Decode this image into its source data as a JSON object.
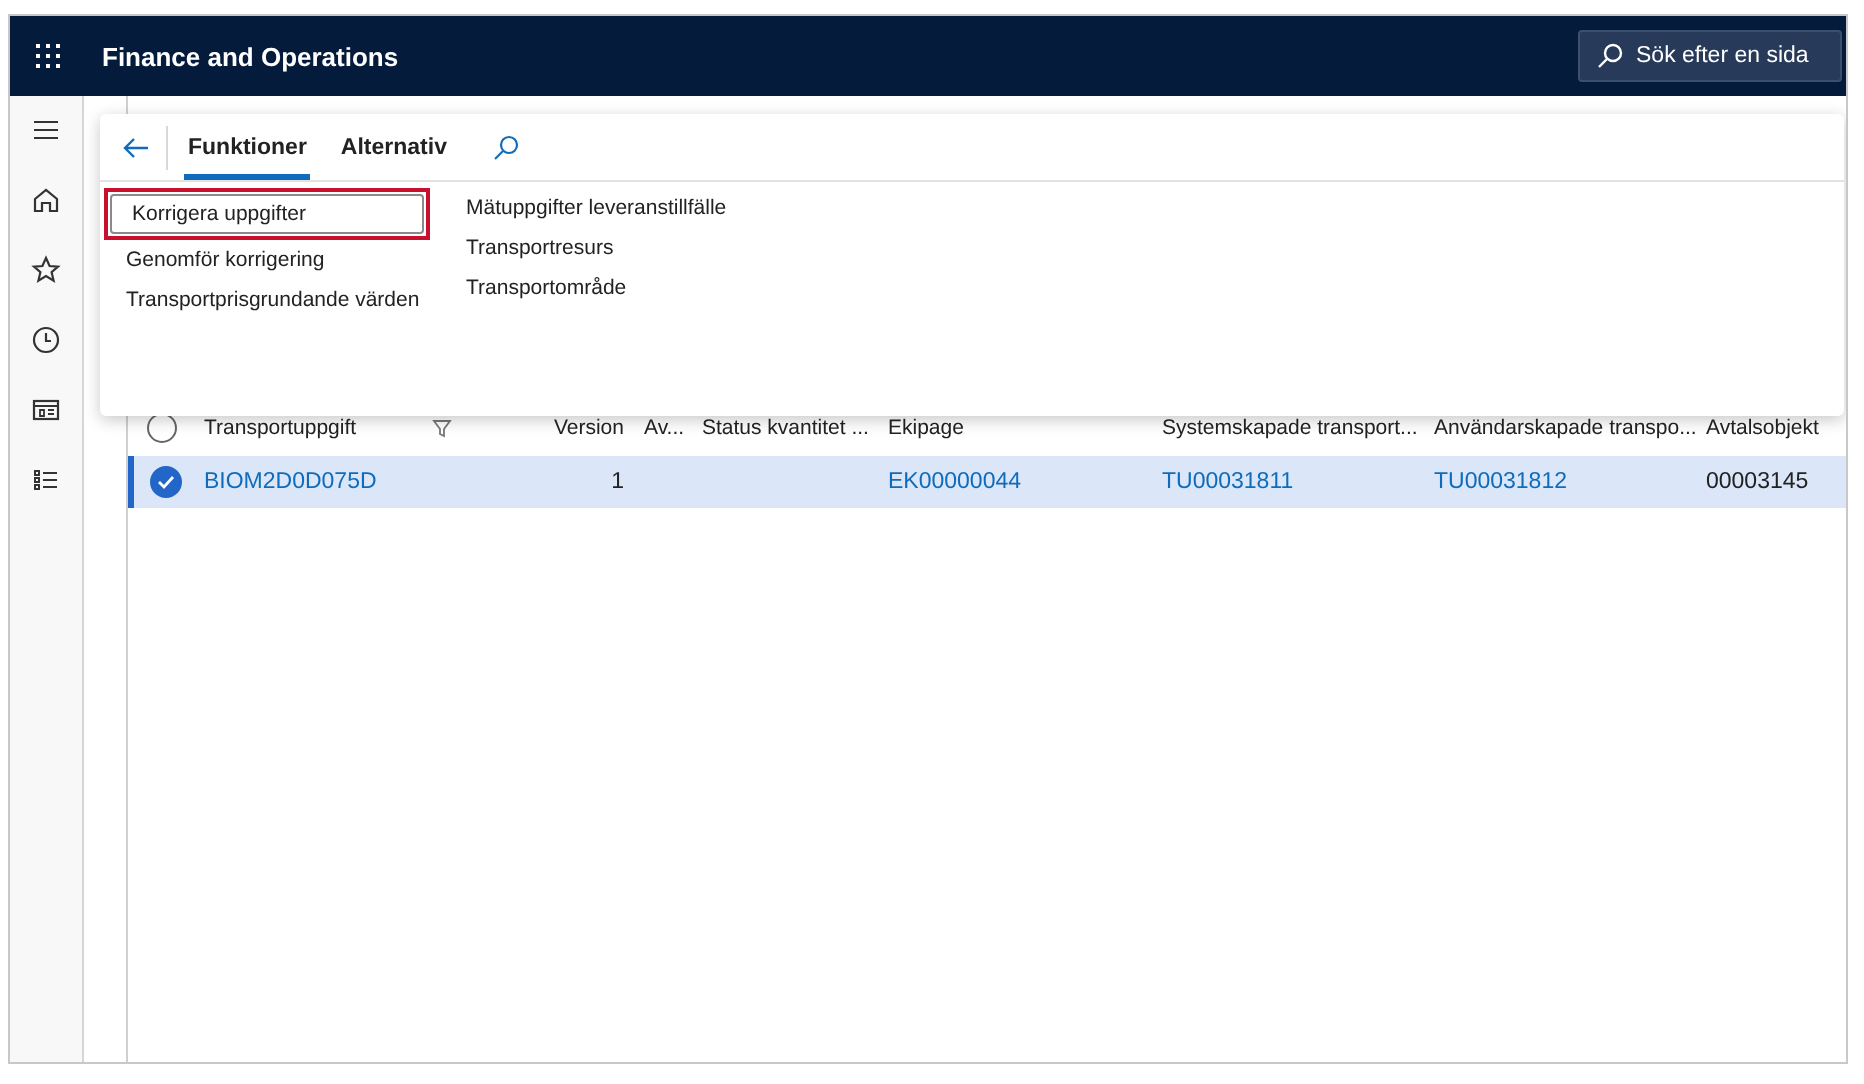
{
  "app_bar": {
    "title": "Finance and Operations",
    "search": {
      "placeholder": "Sök efter en sida"
    }
  },
  "action_pane": {
    "tabs": [
      {
        "label": "Funktioner",
        "selected": true
      },
      {
        "label": "Alternativ",
        "selected": false
      }
    ],
    "menu_columns": [
      [
        {
          "label": "Korrigera uppgifter",
          "focused": true,
          "highlighted": true
        },
        {
          "label": "Genomför korrigering",
          "focused": false,
          "highlighted": false
        },
        {
          "label": "Transportprisgrundande värden",
          "focused": false,
          "highlighted": false
        }
      ],
      [
        {
          "label": "Mätuppgifter leveranstillfälle",
          "focused": false,
          "highlighted": false
        },
        {
          "label": "Transportresurs",
          "focused": false,
          "highlighted": false
        },
        {
          "label": "Transportområde",
          "focused": false,
          "highlighted": false
        }
      ]
    ]
  },
  "grid": {
    "columns": [
      {
        "label": "Transportuppgift"
      },
      {
        "label": "Version"
      },
      {
        "label": "Av..."
      },
      {
        "label": "Status kvantitet ..."
      },
      {
        "label": "Ekipage"
      },
      {
        "label": "Systemskapade transport..."
      },
      {
        "label": "Användarskapade transpo..."
      },
      {
        "label": "Avtalsobjekt"
      }
    ],
    "all_selected": false,
    "rows": [
      {
        "selected": true,
        "cells": [
          {
            "kind": "link",
            "text": "BIOM2D0D075D"
          },
          {
            "kind": "number",
            "text": "1"
          },
          null,
          null,
          {
            "kind": "link",
            "text": "EK00000044"
          },
          {
            "kind": "link",
            "text": "TU00031811"
          },
          {
            "kind": "link",
            "text": "TU00031812"
          },
          {
            "kind": "text",
            "text": "00003145"
          }
        ]
      }
    ]
  }
}
